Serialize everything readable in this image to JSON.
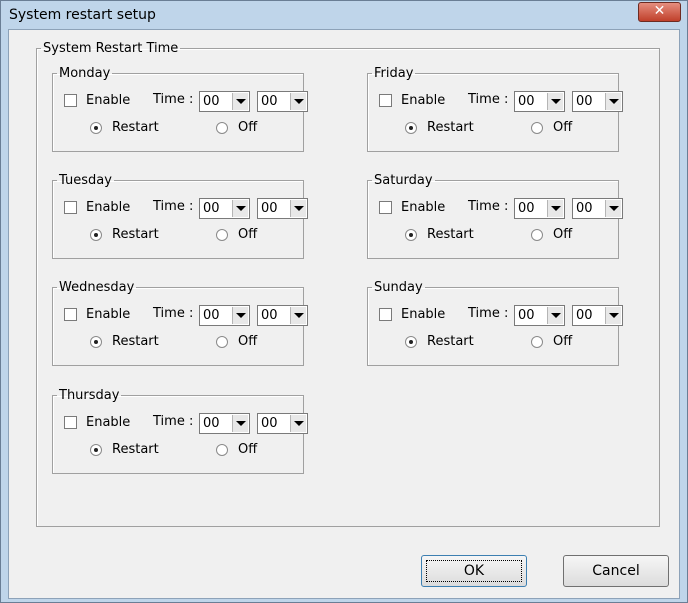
{
  "window": {
    "title": "System restart setup",
    "close_glyph": "✕"
  },
  "group": {
    "title": "System Restart Time"
  },
  "labels": {
    "enable": "Enable",
    "time": "Time :",
    "restart": "Restart",
    "off": "Off"
  },
  "days": [
    {
      "name": "Monday",
      "enabled": false,
      "hour": "00",
      "minute": "00",
      "mode": "Restart"
    },
    {
      "name": "Tuesday",
      "enabled": false,
      "hour": "00",
      "minute": "00",
      "mode": "Restart"
    },
    {
      "name": "Wednesday",
      "enabled": false,
      "hour": "00",
      "minute": "00",
      "mode": "Restart"
    },
    {
      "name": "Thursday",
      "enabled": false,
      "hour": "00",
      "minute": "00",
      "mode": "Restart"
    },
    {
      "name": "Friday",
      "enabled": false,
      "hour": "00",
      "minute": "00",
      "mode": "Restart"
    },
    {
      "name": "Saturday",
      "enabled": false,
      "hour": "00",
      "minute": "00",
      "mode": "Restart"
    },
    {
      "name": "Sunday",
      "enabled": false,
      "hour": "00",
      "minute": "00",
      "mode": "Restart"
    }
  ],
  "buttons": {
    "ok": "OK",
    "cancel": "Cancel"
  },
  "colors": {
    "frame": "#bfd5ea",
    "close": "#c0402b",
    "client": "#f0f0f0"
  }
}
